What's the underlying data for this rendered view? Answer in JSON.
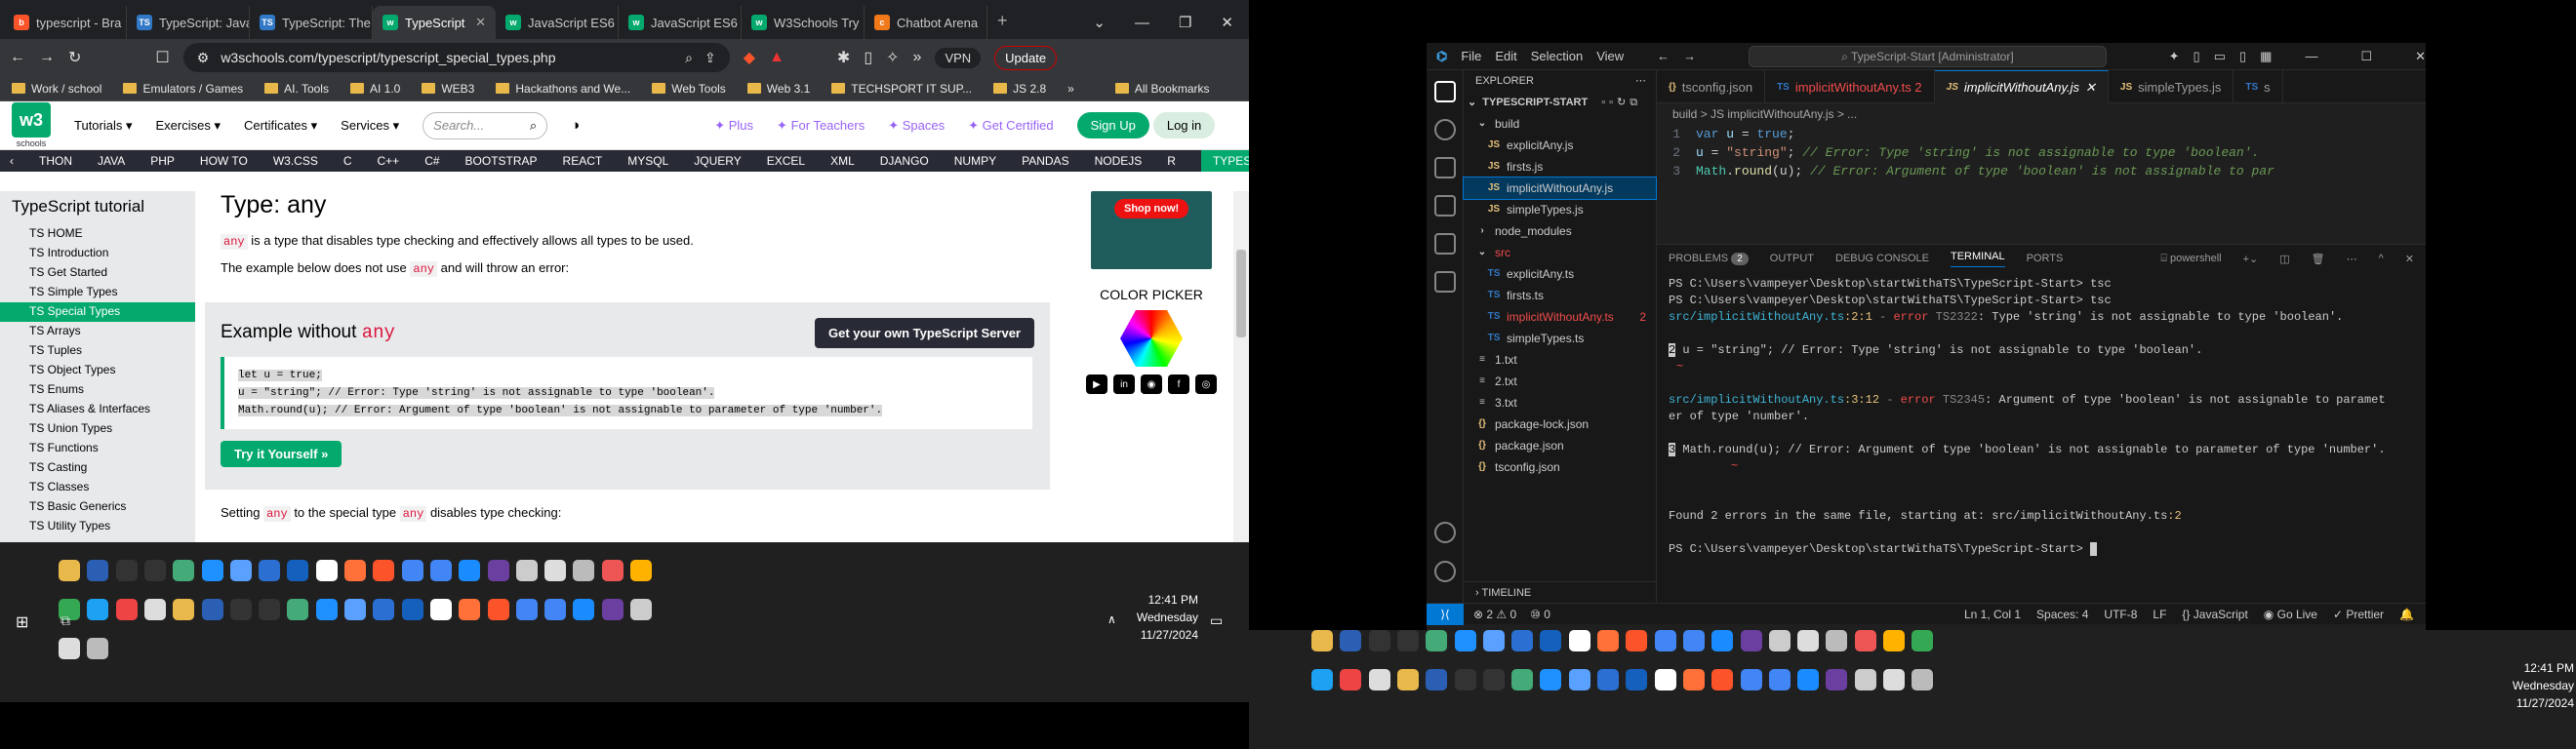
{
  "browser": {
    "tabs": [
      {
        "label": "typescript - Bra",
        "fav_color": "#fb542b",
        "fav": "b"
      },
      {
        "label": "TypeScript: Java",
        "fav_color": "#3178c6",
        "fav": "TS"
      },
      {
        "label": "TypeScript: The",
        "fav_color": "#3178c6",
        "fav": "TS"
      },
      {
        "label": "TypeScript",
        "fav_color": "#04aa6d",
        "fav": "w",
        "active": true
      },
      {
        "label": "JavaScript ES6",
        "fav_color": "#04aa6d",
        "fav": "w"
      },
      {
        "label": "JavaScript ES6",
        "fav_color": "#04aa6d",
        "fav": "w"
      },
      {
        "label": "W3Schools Try",
        "fav_color": "#04aa6d",
        "fav": "w"
      },
      {
        "label": "Chatbot Arena",
        "fav_color": "#f07a1a",
        "fav": "c"
      }
    ],
    "new_tab": "+",
    "url": "w3schools.com/typescript/typescript_special_types.php",
    "vpn": "VPN",
    "update_btn": "Update",
    "bookmarks": [
      "Work / school",
      "Emulators / Games",
      "AI. Tools",
      "AI 1.0",
      "WEB3",
      "Hackathons and We...",
      "Web Tools",
      "Web 3.1",
      "TECHSPORT IT SUP...",
      "JS 2.8"
    ],
    "bookmarks_more": "»",
    "all_bookmarks": "All Bookmarks"
  },
  "w3": {
    "logo": "w3",
    "logo_sub": "schools",
    "nav": [
      "Tutorials ▾",
      "Exercises ▾",
      "Certificates ▾",
      "Services ▾"
    ],
    "search_placeholder": "Search...",
    "plus": "Plus",
    "teachers": "For Teachers",
    "spaces": "Spaces",
    "certified": "Get Certified",
    "signup": "Sign Up",
    "login": "Log in",
    "subnav": [
      "THON",
      "JAVA",
      "PHP",
      "HOW TO",
      "W3.CSS",
      "C",
      "C++",
      "C#",
      "BOOTSTRAP",
      "REACT",
      "MYSQL",
      "JQUERY",
      "EXCEL",
      "XML",
      "DJANGO",
      "NUMPY",
      "PANDAS",
      "NODEJS",
      "R",
      "TYPESCRIPT"
    ],
    "sidebar_title": "TypeScript tutorial",
    "sidebar": [
      "TS HOME",
      "TS Introduction",
      "TS Get Started",
      "TS Simple Types",
      "TS Special Types",
      "TS Arrays",
      "TS Tuples",
      "TS Object Types",
      "TS Enums",
      "TS Aliases & Interfaces",
      "TS Union Types",
      "TS Functions",
      "TS Casting",
      "TS Classes",
      "TS Basic Generics",
      "TS Utility Types"
    ],
    "sidebar_active": 4,
    "heading": "Type: any",
    "p1_code": "any",
    "p1_text": " is a type that disables type checking and effectively allows all types to be used.",
    "p2_a": "The example below does not use ",
    "p2_code": "any",
    "p2_b": " and will throw an error:",
    "example_title": "Example without ",
    "example_code": "any",
    "server_btn": "Get your own TypeScript Server",
    "code_lines": [
      "let u = true;",
      "u = \"string\"; // Error: Type 'string' is not assignable to type 'boolean'.",
      "Math.round(u); // Error: Argument of type 'boolean' is not assignable to parameter of type 'number'."
    ],
    "try_btn": "Try it Yourself »",
    "p3_a": "Setting ",
    "p3_code1": "any",
    "p3_b": " to the special type ",
    "p3_code2": "any",
    "p3_c": " disables type checking:",
    "ad_btn": "Shop now!",
    "color_picker": "COLOR PICKER"
  },
  "taskbar_left": {
    "time": "12:41 PM",
    "day": "Wednesday",
    "date": "11/27/2024"
  },
  "taskbar_right": {
    "time": "12:41 PM",
    "day": "Wednesday",
    "date": "11/27/2024"
  },
  "vscode": {
    "menu": [
      "File",
      "Edit",
      "Selection",
      "View"
    ],
    "search": "TypeScript-Start [Administrator]",
    "explorer_title": "EXPLORER",
    "root": "TYPESCRIPT-START",
    "tree": [
      {
        "label": "build",
        "indent": 1,
        "type": "folder-open",
        "color": "#ccc"
      },
      {
        "label": "explicitAny.js",
        "indent": 2,
        "type": "js"
      },
      {
        "label": "firsts.js",
        "indent": 2,
        "type": "js"
      },
      {
        "label": "implicitWithoutAny.js",
        "indent": 2,
        "type": "js",
        "selected": true
      },
      {
        "label": "simpleTypes.js",
        "indent": 2,
        "type": "js"
      },
      {
        "label": "node_modules",
        "indent": 1,
        "type": "folder"
      },
      {
        "label": "src",
        "indent": 1,
        "type": "folder-open",
        "color": "#f14c4c"
      },
      {
        "label": "explicitAny.ts",
        "indent": 2,
        "type": "ts"
      },
      {
        "label": "firsts.ts",
        "indent": 2,
        "type": "ts"
      },
      {
        "label": "implicitWithoutAny.ts",
        "indent": 2,
        "type": "ts",
        "color": "#f14c4c",
        "badge": "2"
      },
      {
        "label": "simpleTypes.ts",
        "indent": 2,
        "type": "ts"
      },
      {
        "label": "1.txt",
        "indent": 1,
        "type": "txt"
      },
      {
        "label": "2.txt",
        "indent": 1,
        "type": "txt"
      },
      {
        "label": "3.txt",
        "indent": 1,
        "type": "txt"
      },
      {
        "label": "package-lock.json",
        "indent": 1,
        "type": "json"
      },
      {
        "label": "package.json",
        "indent": 1,
        "type": "json"
      },
      {
        "label": "tsconfig.json",
        "indent": 1,
        "type": "json"
      }
    ],
    "timeline": "TIMELINE",
    "tabs": [
      {
        "label": "tsconfig.json",
        "icon": "{}"
      },
      {
        "label": "implicitWithoutAny.ts 2",
        "icon": "TS",
        "color": "#f14c4c"
      },
      {
        "label": "implicitWithoutAny.js",
        "icon": "JS",
        "active": true
      },
      {
        "label": "simpleTypes.js",
        "icon": "JS"
      },
      {
        "label": "s",
        "icon": "TS"
      }
    ],
    "breadcrumb": "build > JS implicitWithoutAny.js > ...",
    "code": [
      {
        "n": "1",
        "parts": [
          {
            "t": "var ",
            "c": "#569cd6"
          },
          {
            "t": "u",
            "c": "#9cdcfe"
          },
          {
            "t": " = ",
            "c": "#ccc"
          },
          {
            "t": "true",
            "c": "#569cd6"
          },
          {
            "t": ";",
            "c": "#ccc"
          }
        ]
      },
      {
        "n": "2",
        "parts": [
          {
            "t": "u",
            "c": "#9cdcfe"
          },
          {
            "t": " = ",
            "c": "#ccc"
          },
          {
            "t": "\"string\"",
            "c": "#ce9178"
          },
          {
            "t": "; ",
            "c": "#ccc"
          },
          {
            "t": "// Error: Type 'string' is not assignable to type 'boolean'.",
            "c": "#6a9955"
          }
        ]
      },
      {
        "n": "3",
        "parts": [
          {
            "t": "Math",
            "c": "#4ec9b0"
          },
          {
            "t": ".",
            "c": "#ccc"
          },
          {
            "t": "round",
            "c": "#dcdcaa"
          },
          {
            "t": "(u); ",
            "c": "#ccc"
          },
          {
            "t": "// Error: Argument of type 'boolean' is not assignable to par",
            "c": "#6a9955"
          }
        ]
      }
    ],
    "panel_tabs": [
      "PROBLEMS",
      "OUTPUT",
      "DEBUG CONSOLE",
      "TERMINAL",
      "PORTS"
    ],
    "problems_count": "2",
    "shell": "powershell",
    "terminal": {
      "p1": "PS C:\\Users\\vampeyer\\Desktop\\startWithaTS\\TypeScript-Start> tsc",
      "p2": "PS C:\\Users\\vampeyer\\Desktop\\startWithaTS\\TypeScript-Start> tsc",
      "e1_file": "src/implicitWithoutAny.ts",
      "e1_loc": ":2:1",
      "e1_sep": " - ",
      "e1_err": "error",
      "e1_code": " TS2322",
      "e1_msg": ": Type 'string' is not assignable to type 'boolean'.",
      "e1_num": "2",
      "e1_src": " u = \"string\"; // Error: Type 'string' is not assignable to type 'boolean'.",
      "e1_mark": "~",
      "e2_file": "src/implicitWithoutAny.ts",
      "e2_loc": ":3:12",
      "e2_err": "error",
      "e2_code": " TS2345",
      "e2_msg": ": Argument of type 'boolean' is not assignable to paramet",
      "e2_msg2": "er of type 'number'.",
      "e2_num": "3",
      "e2_src": " Math.round(u); // Error: Argument of type 'boolean' is not assignable to parameter of type 'number'.",
      "e2_mark": "~",
      "found_a": "Found 2 errors in the same file, starting at: ",
      "found_b": "src/implicitWithoutAny.ts",
      "found_c": ":2",
      "p3": "PS C:\\Users\\vampeyer\\Desktop\\startWithaTS\\TypeScript-Start> "
    },
    "status": {
      "problems": "⊗ 2 ⚠ 0",
      "ports": "⑩ 0",
      "pos": "Ln 1, Col 1",
      "spaces": "Spaces: 4",
      "enc": "UTF-8",
      "eol": "LF",
      "lang": "{} JavaScript",
      "golive": "Go Live",
      "prettier": "✓ Prettier"
    }
  }
}
